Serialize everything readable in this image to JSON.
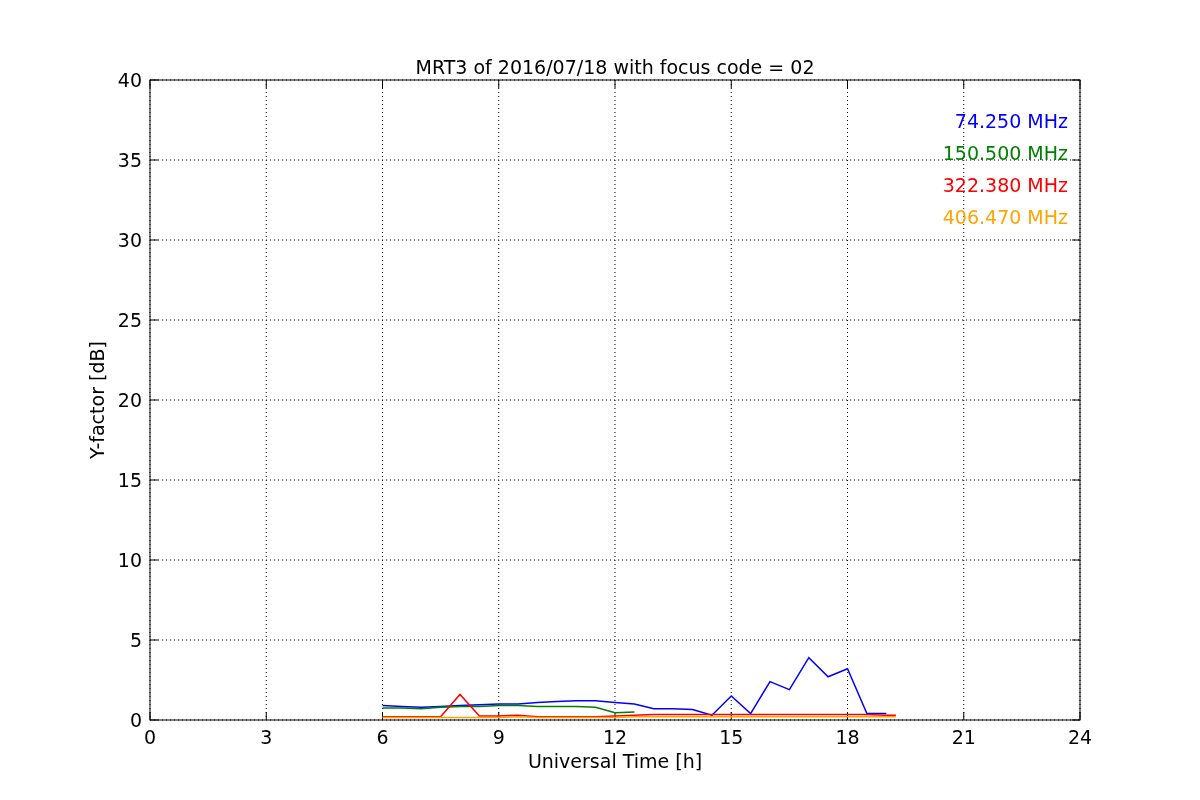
{
  "chart_data": {
    "type": "line",
    "title": "MRT3 of 2016/07/18 with focus code = 02",
    "xlabel": "Universal Time [h]",
    "ylabel": "Y-factor [dB]",
    "x": [
      6,
      6.5,
      7,
      7.5,
      8,
      8.5,
      9,
      9.5,
      10,
      10.5,
      11,
      11.5,
      12,
      12.5,
      13,
      13.5,
      14,
      14.5,
      15,
      15.5,
      16,
      16.5,
      17,
      17.5,
      18,
      18.5,
      19,
      19.25
    ],
    "series": [
      {
        "name": "74.250 MHz",
        "color": "#0000ff",
        "values": [
          0.9,
          0.85,
          0.8,
          0.85,
          0.9,
          0.95,
          1.0,
          1.0,
          1.1,
          1.15,
          1.2,
          1.2,
          1.1,
          1.0,
          0.7,
          0.7,
          0.65,
          0.3,
          1.5,
          0.4,
          2.4,
          1.9,
          3.9,
          2.7,
          3.2,
          0.4,
          0.4,
          null
        ]
      },
      {
        "name": "150.500 MHz",
        "color": "#008000",
        "values": [
          0.75,
          0.75,
          0.7,
          0.8,
          0.85,
          0.85,
          0.9,
          0.9,
          0.85,
          0.85,
          0.85,
          0.8,
          0.45,
          0.5,
          null,
          null,
          null,
          null,
          null,
          null,
          null,
          null,
          null,
          null,
          null,
          null,
          null,
          null
        ]
      },
      {
        "name": "322.380 MHz",
        "color": "#ff0000",
        "values": [
          0.2,
          0.2,
          0.2,
          0.2,
          1.6,
          0.25,
          0.25,
          0.3,
          0.2,
          0.2,
          0.2,
          0.2,
          0.25,
          0.3,
          0.35,
          0.35,
          0.35,
          0.35,
          0.35,
          0.35,
          0.35,
          0.35,
          0.35,
          0.35,
          0.35,
          0.35,
          0.3,
          0.3
        ]
      },
      {
        "name": "406.470 MHz",
        "color": "#ffa500",
        "values": [
          0.15,
          0.15,
          0.15,
          0.15,
          0.15,
          0.15,
          0.15,
          0.2,
          0.15,
          0.15,
          0.15,
          0.15,
          0.15,
          0.2,
          0.2,
          0.2,
          0.2,
          0.2,
          0.2,
          0.2,
          0.2,
          0.2,
          0.2,
          0.2,
          0.2,
          0.2,
          0.2,
          0.2
        ]
      }
    ],
    "grid": true,
    "xlim": [
      0,
      24
    ],
    "ylim": [
      0,
      40
    ],
    "xticks": [
      0,
      3,
      6,
      9,
      12,
      15,
      18,
      21,
      24
    ],
    "yticks": [
      0,
      5,
      10,
      15,
      20,
      25,
      30,
      35,
      40
    ]
  }
}
